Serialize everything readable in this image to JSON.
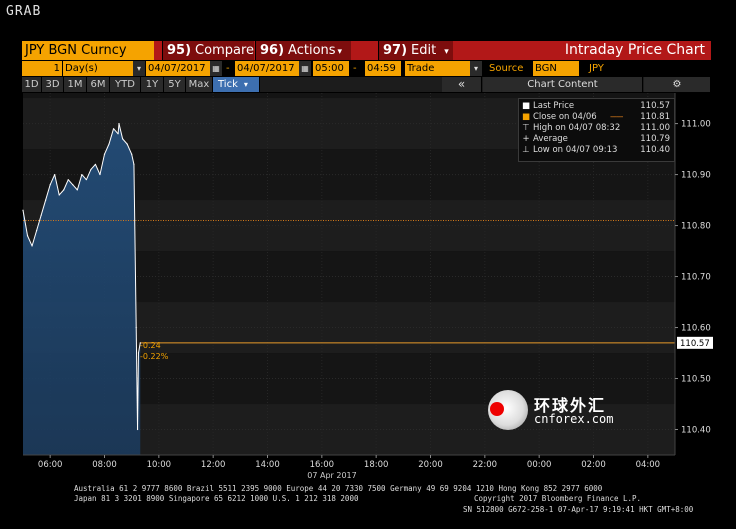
{
  "window": {
    "title": "GRAB"
  },
  "menubar": {
    "ticker": "JPY BGN Curncy",
    "compare": {
      "num": "95)",
      "label": "Compare"
    },
    "actions": {
      "num": "96)",
      "label": "Actions"
    },
    "edit": {
      "num": "97)",
      "label": "Edit"
    },
    "chart_title": "Intraday Price Chart"
  },
  "params": {
    "period_value": "1",
    "period_unit": "Day(s)",
    "start_date": "04/07/2017",
    "date_sep": "-",
    "end_date": "04/07/2017",
    "start_time": "05:00",
    "time_sep": "-",
    "end_time": "04:59",
    "type": "Trade",
    "source_label": "Source",
    "source": "BGN",
    "currency": "JPY"
  },
  "ranges": {
    "buttons": [
      "1D",
      "3D",
      "1M",
      "6M",
      "YTD",
      "1Y",
      "5Y",
      "Max",
      "Tick"
    ],
    "active": "Tick",
    "collapse_icon": "«",
    "chart_content_label": "Chart Content",
    "settings_icon": "gear-icon"
  },
  "legend": {
    "last_price": {
      "label": "Last Price",
      "value": "110.57"
    },
    "close": {
      "label": "Close on 04/06",
      "value": "110.81"
    },
    "high": {
      "label": "High on 04/07 08:32",
      "value": "111.00"
    },
    "average": {
      "label": "Average",
      "value": "110.79"
    },
    "low": {
      "label": "Low on 04/07 09:13",
      "value": "110.40"
    }
  },
  "annotations": {
    "change_abs": "-0.24",
    "change_pct": "-0.22%",
    "last_price_tag": "110.57",
    "date_label": "07 Apr 2017"
  },
  "watermark": {
    "cn": "环球外汇",
    "en": "cnforex.com"
  },
  "footer": {
    "line1": "Australia 61 2 9777 8600 Brazil 5511 2395 9000 Europe 44 20 7330 7500 Germany 49 69 9204 1210 Hong Kong 852 2977 6000",
    "line2_left": "Japan 81 3 3201 8900       Singapore 65 6212 1000       U.S. 1 212 318 2000",
    "line2_right": "Copyright 2017 Bloomberg Finance L.P.",
    "line3": "SN 512800 G672-258-1 07-Apr-17   9:19:41 HKT  GMT+8:00"
  },
  "colors": {
    "accent_orange": "#f5a300",
    "menubar_red": "#b21818",
    "price_line": "#ffffff",
    "area_fill": "#1b3a5c",
    "close_line": "#d67a1a",
    "last_price_line": "#e89a2a"
  },
  "chart_data": {
    "type": "area",
    "title": "Intraday Price Chart",
    "series": [
      {
        "name": "Last Price",
        "x": [
          "05:00",
          "05:10",
          "05:20",
          "05:30",
          "05:40",
          "05:50",
          "06:00",
          "06:10",
          "06:20",
          "06:30",
          "06:40",
          "06:50",
          "07:00",
          "07:10",
          "07:20",
          "07:30",
          "07:40",
          "07:50",
          "08:00",
          "08:10",
          "08:20",
          "08:30",
          "08:32",
          "08:40",
          "08:50",
          "09:00",
          "09:05",
          "09:10",
          "09:13",
          "09:15",
          "09:19"
        ],
        "values": [
          110.83,
          110.78,
          110.76,
          110.79,
          110.82,
          110.85,
          110.88,
          110.9,
          110.86,
          110.87,
          110.89,
          110.88,
          110.87,
          110.9,
          110.89,
          110.91,
          110.92,
          110.9,
          110.94,
          110.96,
          110.99,
          110.98,
          111.0,
          110.97,
          110.96,
          110.94,
          110.92,
          110.6,
          110.4,
          110.55,
          110.57
        ]
      }
    ],
    "y_ticks": [
      "111.00",
      "110.90",
      "110.80",
      "110.70",
      "110.60",
      "110.50",
      "110.40"
    ],
    "ylim": [
      110.35,
      111.06
    ],
    "x_ticks": [
      "06:00",
      "08:00",
      "10:00",
      "12:00",
      "14:00",
      "16:00",
      "18:00",
      "20:00",
      "22:00",
      "00:00",
      "02:00",
      "04:00"
    ],
    "x_tick_minutes": [
      60,
      180,
      300,
      420,
      540,
      660,
      780,
      900,
      1020,
      1140,
      1260,
      1380
    ],
    "xlim_minutes": [
      0,
      1440
    ],
    "close_prev": 110.81,
    "last_price": 110.57,
    "grid": true
  }
}
